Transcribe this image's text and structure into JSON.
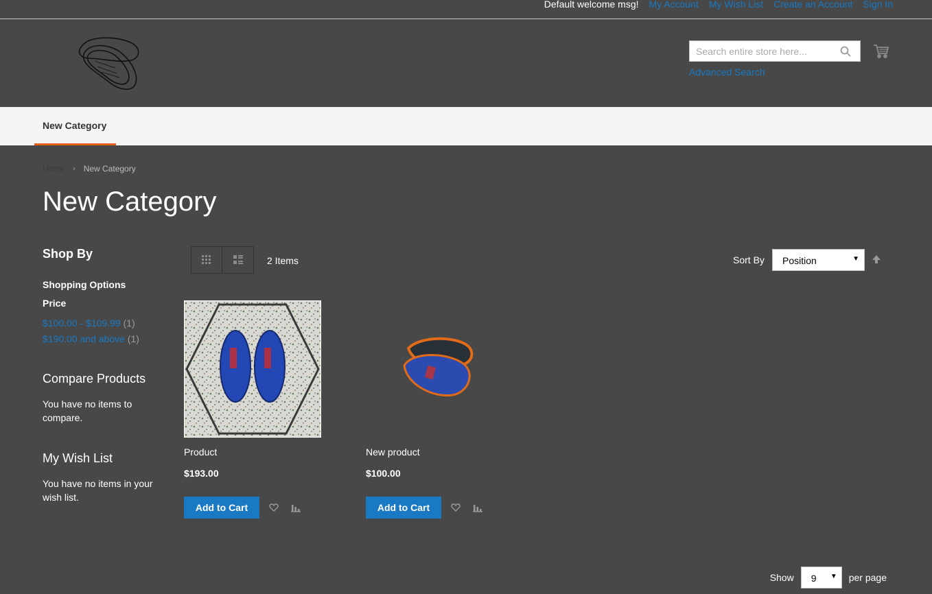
{
  "topbar": {
    "welcome": "Default welcome msg!",
    "links": [
      "My Account",
      "My Wish List",
      "Create an Account",
      "Sign In"
    ]
  },
  "header": {
    "logo_icon": "insoles-logo-icon",
    "search_placeholder": "Search entire store here...",
    "advanced_search": "Advanced Search",
    "cart_icon": "cart-icon"
  },
  "nav": {
    "item": "New Category"
  },
  "breadcrumb": {
    "home": "Home",
    "current": "New Category"
  },
  "page_title": "New Category",
  "sidebar": {
    "shop_by": "Shop By",
    "shopping_options": "Shopping Options",
    "price_title": "Price",
    "filters": [
      {
        "label": "$100.00 - $109.99",
        "count": "(1)"
      },
      {
        "label": "$190.00 and above",
        "count": "(1)"
      }
    ],
    "compare_title": "Compare Products",
    "compare_text": "You have no items to compare.",
    "wish_title": "My Wish List",
    "wish_text": "You have no items in your wish list."
  },
  "toolbar": {
    "items_count": "2 Items",
    "sort_label": "Sort By",
    "sort_value": "Position"
  },
  "products": [
    {
      "name": "Product",
      "price": "$193.00",
      "button": "Add to Cart"
    },
    {
      "name": "New product",
      "price": "$100.00",
      "button": "Add to Cart"
    }
  ],
  "pager": {
    "show": "Show",
    "limit": "9",
    "per_page": "per page"
  },
  "colors": {
    "accent": "#1979c3",
    "nav_active": "#e65e1a",
    "background": "#484848"
  }
}
